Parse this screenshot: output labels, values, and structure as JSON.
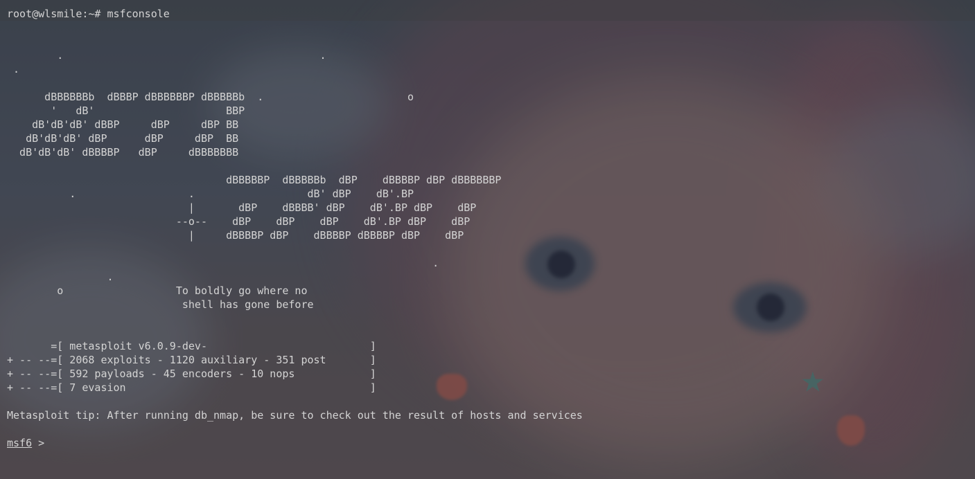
{
  "terminal": {
    "command_line": "root@wlsmile:~# msfconsole",
    "banner_lines": [
      "",
      "",
      "        .                                         .",
      " .",
      "",
      "      dBBBBBBb  dBBBP dBBBBBBP dBBBBBb  .                       o",
      "       '   dB'                     BBP",
      "    dB'dB'dB' dBBP     dBP     dBP BB",
      "   dB'dB'dB' dBP      dBP     dBP  BB",
      "  dB'dB'dB' dBBBBP   dBP     dBBBBBBB",
      "",
      "                                   dBBBBBP  dBBBBBb  dBP    dBBBBP dBP dBBBBBBP",
      "          .                  .                  dB' dBP    dB'.BP",
      "                             |       dBP    dBBBB' dBP    dB'.BP dBP    dBP",
      "                           --o--    dBP    dBP    dBP    dB'.BP dBP    dBP",
      "                             |     dBBBBP dBP    dBBBBP dBBBBP dBP    dBP",
      "",
      "                                                                    .",
      "                .",
      "        o                  To boldly go where no",
      "                            shell has gone before",
      "",
      "",
      "       =[ metasploit v6.0.9-dev-                          ]",
      "+ -- --=[ 2068 exploits - 1120 auxiliary - 351 post       ]",
      "+ -- --=[ 592 payloads - 45 encoders - 10 nops            ]",
      "+ -- --=[ 7 evasion                                       ]",
      "",
      "Metasploit tip: After running db_nmap, be sure to check out the result of hosts and services",
      ""
    ],
    "prompt_label": "msf6",
    "prompt_symbol": " >"
  }
}
